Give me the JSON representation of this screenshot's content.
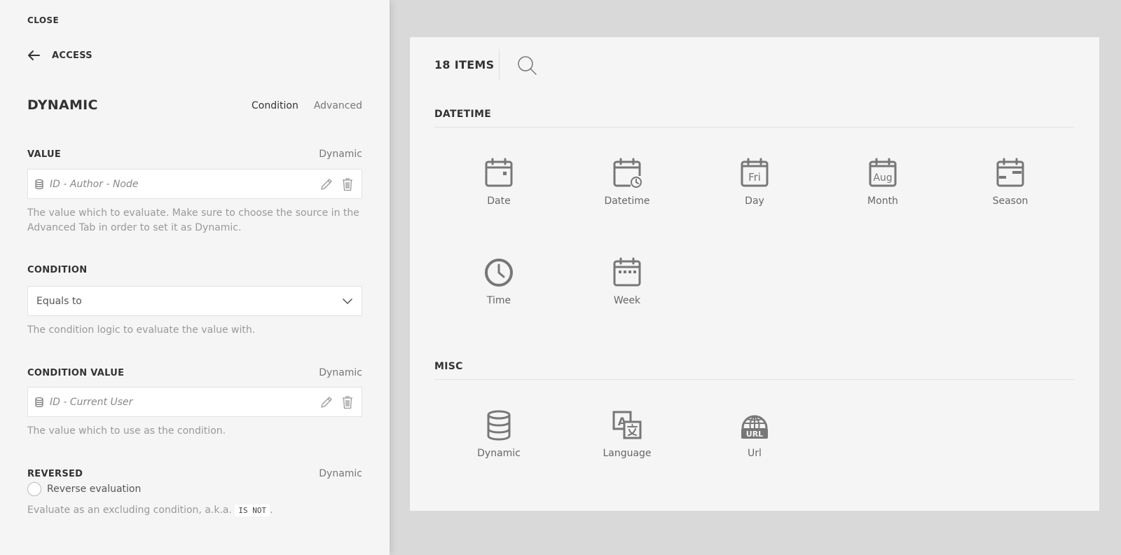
{
  "left": {
    "close": "CLOSE",
    "back": "ACCESS",
    "title": "DYNAMIC",
    "tabs": {
      "condition": "Condition",
      "advanced": "Advanced"
    },
    "value": {
      "label": "VALUE",
      "mode": "Dynamic",
      "field": "ID - Author - Node",
      "help": "The value which to evaluate. Make sure to choose the source in the Advanced Tab in order to set it as Dynamic."
    },
    "condition": {
      "label": "CONDITION",
      "selected": "Equals to",
      "help": "The condition logic to evaluate the value with."
    },
    "condition_value": {
      "label": "CONDITION VALUE",
      "mode": "Dynamic",
      "field": "ID - Current User",
      "help": "The value which to use as the condition."
    },
    "reversed": {
      "label": "REVERSED",
      "mode": "Dynamic",
      "option": "Reverse evaluation",
      "help_prefix": "Evaluate as an excluding condition, a.k.a.",
      "help_code": "IS NOT",
      "help_suffix": "."
    }
  },
  "right": {
    "count": "18 ITEMS",
    "sections": [
      {
        "title": "DATETIME",
        "items": [
          {
            "label": "Date",
            "icon": "calendar-date-icon"
          },
          {
            "label": "Datetime",
            "icon": "calendar-clock-icon"
          },
          {
            "label": "Day",
            "icon": "calendar-day-icon",
            "glyph": "Fri"
          },
          {
            "label": "Month",
            "icon": "calendar-month-icon",
            "glyph": "Aug"
          },
          {
            "label": "Season",
            "icon": "calendar-season-icon"
          },
          {
            "label": "Time",
            "icon": "clock-icon"
          },
          {
            "label": "Week",
            "icon": "calendar-week-icon"
          }
        ]
      },
      {
        "title": "MISC",
        "items": [
          {
            "label": "Dynamic",
            "icon": "database-icon"
          },
          {
            "label": "Language",
            "icon": "language-icon"
          },
          {
            "label": "Url",
            "icon": "url-globe-icon",
            "glyph": "URL"
          }
        ]
      }
    ]
  }
}
